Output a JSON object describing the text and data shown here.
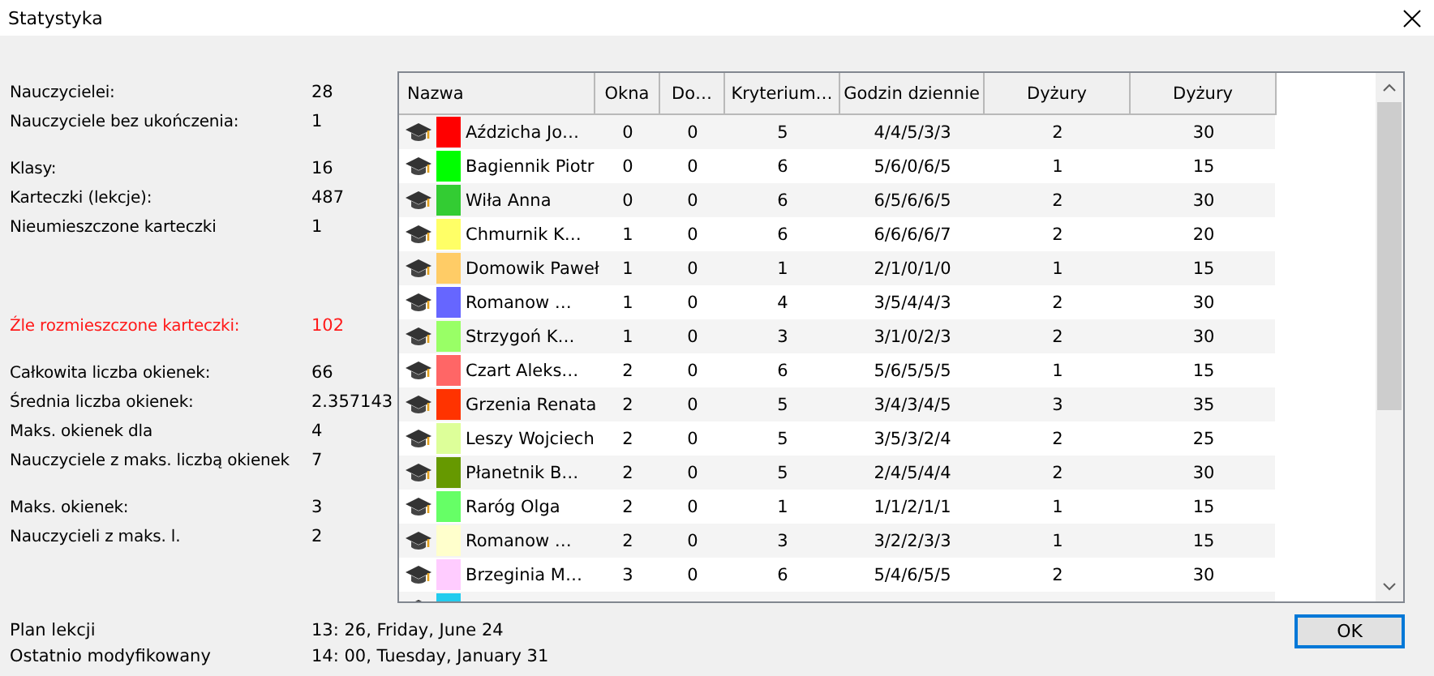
{
  "window": {
    "title": "Statystyka"
  },
  "stats": [
    [
      {
        "label": "Nauczycielei:",
        "value": "28",
        "alert": false
      },
      {
        "label": "Nauczyciele bez ukończenia:",
        "value": "1",
        "alert": false
      }
    ],
    [
      {
        "label": "Klasy:",
        "value": "16",
        "alert": false
      },
      {
        "label": "Karteczki (lekcje):",
        "value": "487",
        "alert": false
      },
      {
        "label": "Nieumieszczone karteczki",
        "value": "1",
        "alert": false
      }
    ],
    [
      {
        "label": "Źle rozmieszczone karteczki:",
        "value": "102",
        "alert": true
      }
    ],
    [
      {
        "label": "Całkowita liczba okienek:",
        "value": "66",
        "alert": false
      },
      {
        "label": "Średnia liczba okienek:",
        "value": "2.357143",
        "alert": false
      },
      {
        "label": "Maks. okienek dla",
        "value": "4",
        "alert": false
      },
      {
        "label": "Nauczyciele z maks. liczbą okienek",
        "value": "7",
        "alert": false
      }
    ],
    [
      {
        "label": "Maks. okienek:",
        "value": "3",
        "alert": false
      },
      {
        "label": "Nauczycieli z maks. l.",
        "value": "2",
        "alert": false
      }
    ]
  ],
  "table": {
    "columns": [
      "Nazwa",
      "Okna",
      "Do…",
      "Kryterium…",
      "Godzin dziennie",
      "Dyżury",
      "Dyżury"
    ],
    "rows": [
      {
        "color": "#ff0000",
        "cells": [
          "Aździcha Jo…",
          "0",
          "0",
          "5",
          "4/4/5/3/3",
          "2",
          "30"
        ]
      },
      {
        "color": "#00ff00",
        "cells": [
          "Bagiennik Piotr",
          "0",
          "0",
          "6",
          "5/6/0/6/5",
          "1",
          "15"
        ]
      },
      {
        "color": "#33cc33",
        "cells": [
          "Wiła Anna",
          "0",
          "0",
          "6",
          "6/5/6/6/5",
          "2",
          "30"
        ]
      },
      {
        "color": "#ffff66",
        "cells": [
          "Chmurnik K…",
          "1",
          "0",
          "6",
          "6/6/6/6/7",
          "2",
          "20"
        ]
      },
      {
        "color": "#ffcc66",
        "cells": [
          "Domowik Paweł",
          "1",
          "0",
          "1",
          "2/1/0/1/0",
          "1",
          "15"
        ]
      },
      {
        "color": "#6666ff",
        "cells": [
          "Romanow …",
          "1",
          "0",
          "4",
          "3/5/4/4/3",
          "2",
          "30"
        ]
      },
      {
        "color": "#99ff66",
        "cells": [
          "Strzygoń K…",
          "1",
          "0",
          "3",
          "3/1/0/2/3",
          "2",
          "30"
        ]
      },
      {
        "color": "#ff6666",
        "cells": [
          "Czart Aleks…",
          "2",
          "0",
          "6",
          "5/6/5/5/5",
          "1",
          "15"
        ]
      },
      {
        "color": "#ff3300",
        "cells": [
          "Grzenia Renata",
          "2",
          "0",
          "5",
          "3/4/3/4/5",
          "3",
          "35"
        ]
      },
      {
        "color": "#ddff99",
        "cells": [
          "Leszy Wojciech",
          "2",
          "0",
          "5",
          "3/5/3/2/4",
          "2",
          "25"
        ]
      },
      {
        "color": "#669900",
        "cells": [
          "Płanetnik B…",
          "2",
          "0",
          "5",
          "2/4/5/4/4",
          "2",
          "30"
        ]
      },
      {
        "color": "#66ff66",
        "cells": [
          "Raróg Olga",
          "2",
          "0",
          "1",
          "1/1/2/1/1",
          "1",
          "15"
        ]
      },
      {
        "color": "#ffffcc",
        "cells": [
          "Romanow …",
          "2",
          "0",
          "3",
          "3/2/2/3/3",
          "1",
          "15"
        ]
      },
      {
        "color": "#ffccff",
        "cells": [
          "Brzeginia M…",
          "3",
          "0",
          "6",
          "5/4/6/5/5",
          "2",
          "30"
        ]
      },
      {
        "color": "#22ccee"
      }
    ]
  },
  "footer": [
    {
      "label": "Plan lekcji",
      "value": "13: 26, Friday, June 24"
    },
    {
      "label": "Ostatnio modyfikowany",
      "value": "14: 00, Tuesday, January 31"
    }
  ],
  "buttons": [
    "OK"
  ]
}
